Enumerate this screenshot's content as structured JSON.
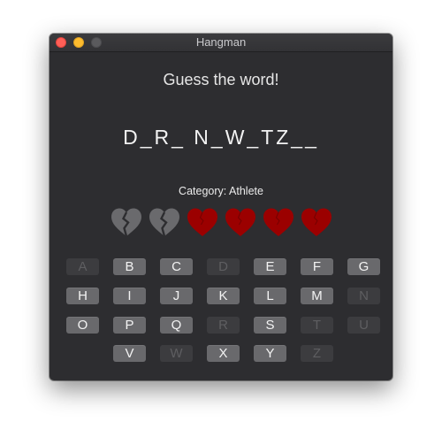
{
  "window": {
    "title": "Hangman"
  },
  "game": {
    "prompt": "Guess the word!",
    "masked_word": "D_R_ N_W_TZ__",
    "category": "Category: Athlete",
    "lives_total": 6,
    "lives_lost": 2
  },
  "colors": {
    "heart_alive": "#9b0000",
    "heart_lost": "#6a6a6d",
    "key_available": "#69696c",
    "key_used": "#3c3c3f"
  },
  "keyboard": {
    "rows": [
      [
        {
          "label": "A",
          "used": true
        },
        {
          "label": "B",
          "used": false
        },
        {
          "label": "C",
          "used": false
        },
        {
          "label": "D",
          "used": true
        },
        {
          "label": "E",
          "used": false
        },
        {
          "label": "F",
          "used": false
        },
        {
          "label": "G",
          "used": false
        }
      ],
      [
        {
          "label": "H",
          "used": false
        },
        {
          "label": "I",
          "used": false
        },
        {
          "label": "J",
          "used": false
        },
        {
          "label": "K",
          "used": false
        },
        {
          "label": "L",
          "used": false
        },
        {
          "label": "M",
          "used": false
        },
        {
          "label": "N",
          "used": true
        }
      ],
      [
        {
          "label": "O",
          "used": false
        },
        {
          "label": "P",
          "used": false
        },
        {
          "label": "Q",
          "used": false
        },
        {
          "label": "R",
          "used": true
        },
        {
          "label": "S",
          "used": false
        },
        {
          "label": "T",
          "used": true
        },
        {
          "label": "U",
          "used": true
        }
      ],
      [
        {
          "label": "V",
          "used": false
        },
        {
          "label": "W",
          "used": true
        },
        {
          "label": "X",
          "used": false
        },
        {
          "label": "Y",
          "used": false
        },
        {
          "label": "Z",
          "used": true
        }
      ]
    ]
  }
}
